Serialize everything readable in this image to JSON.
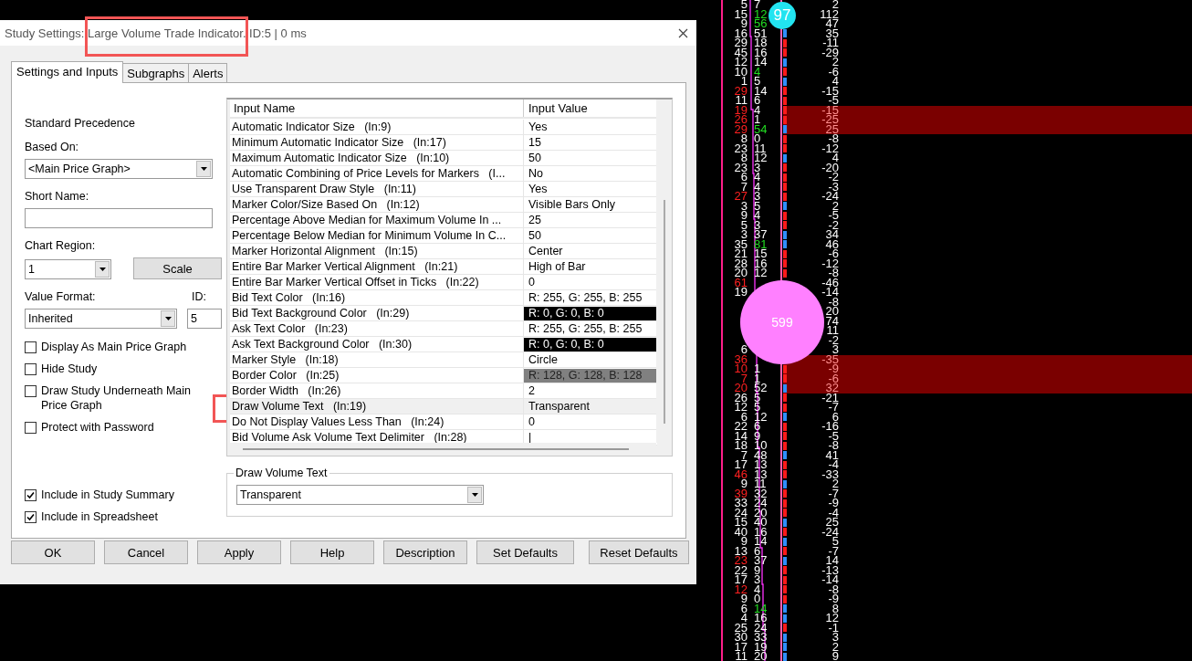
{
  "dialog": {
    "title": "Study Settings: Large Volume Trade Indicator. ID:5 | 0 ms"
  },
  "tabs": [
    {
      "label": "Settings and Inputs",
      "selected": true
    },
    {
      "label": "Subgraphs",
      "selected": false
    },
    {
      "label": "Alerts",
      "selected": false
    }
  ],
  "settings": {
    "precedence": "Standard Precedence",
    "based_on": {
      "label": "Based On:",
      "value": "<Main Price Graph>"
    },
    "short_name": {
      "label": "Short Name:"
    },
    "chart_region": {
      "label": "Chart Region:",
      "value": "1"
    },
    "scale_button": "Scale",
    "value_format": {
      "label": "Value Format:",
      "value": "Inherited"
    },
    "id": {
      "label": "ID:",
      "value": "5"
    }
  },
  "options": [
    {
      "label": "Display As Main Price Graph",
      "checked": false
    },
    {
      "label": "Hide Study",
      "checked": false
    },
    {
      "label": "Draw Study Underneath Main Price Graph",
      "checked": false
    },
    {
      "label": "Protect with Password",
      "checked": false
    }
  ],
  "summary_options": [
    {
      "label": "Include in Study Summary",
      "checked": true
    },
    {
      "label": "Include in Spreadsheet",
      "checked": true
    }
  ],
  "inputs": {
    "columns": [
      "Input Name",
      "Input Value"
    ],
    "rows": [
      {
        "name": "Automatic Indicator Size   (In:9)",
        "value": "Yes",
        "kind": "text",
        "selected": false
      },
      {
        "name": "Minimum Automatic Indicator Size   (In:17)",
        "value": "15",
        "kind": "text",
        "selected": false
      },
      {
        "name": "Maximum Automatic Indicator Size   (In:10)",
        "value": "50",
        "kind": "text",
        "selected": false
      },
      {
        "name": "Automatic Combining of Price Levels for Markers   (I...",
        "value": "No",
        "kind": "text",
        "selected": false
      },
      {
        "name": "Use Transparent Draw Style   (In:11)",
        "value": "Yes",
        "kind": "text",
        "selected": false
      },
      {
        "name": "Marker Color/Size Based On   (In:12)",
        "value": "Visible Bars Only",
        "kind": "text",
        "selected": false
      },
      {
        "name": "Percentage Above Median for Maximum Volume In ...",
        "value": "25",
        "kind": "text",
        "selected": false
      },
      {
        "name": "Percentage Below Median for Minimum Volume In C...",
        "value": "50",
        "kind": "text",
        "selected": false
      },
      {
        "name": "Marker Horizontal Alignment   (In:15)",
        "value": "Center",
        "kind": "text",
        "selected": false
      },
      {
        "name": "Entire Bar Marker Vertical Alignment   (In:21)",
        "value": "High of Bar",
        "kind": "text",
        "selected": false
      },
      {
        "name": "Entire Bar Marker Vertical Offset in Ticks   (In:22)",
        "value": "0",
        "kind": "text",
        "selected": false
      },
      {
        "name": "Bid Text Color   (In:16)",
        "value": "R: 255, G: 255, B: 255",
        "kind": "color",
        "color": "#ffffff",
        "selected": false
      },
      {
        "name": "Bid Text Background Color   (In:29)",
        "value": "R: 0, G: 0, B: 0",
        "kind": "color",
        "color": "#000000",
        "selected": false
      },
      {
        "name": "Ask Text Color   (In:23)",
        "value": "R: 255, G: 255, B: 255",
        "kind": "color",
        "color": "#ffffff",
        "selected": false
      },
      {
        "name": "Ask Text Background Color   (In:30)",
        "value": "R: 0, G: 0, B: 0",
        "kind": "color",
        "color": "#000000",
        "selected": false
      },
      {
        "name": "Marker Style   (In:18)",
        "value": "Circle",
        "kind": "text",
        "selected": false
      },
      {
        "name": "Border Color   (In:25)",
        "value": "R: 128, G: 128, B: 128",
        "kind": "color",
        "color": "#808080",
        "selected": false
      },
      {
        "name": "Border Width   (In:26)",
        "value": "2",
        "kind": "text",
        "selected": false
      },
      {
        "name": "Draw Volume Text   (In:19)",
        "value": "Transparent",
        "kind": "text",
        "selected": true
      },
      {
        "name": "Do Not Display Values Less Than   (In:24)",
        "value": "0",
        "kind": "text",
        "selected": false
      },
      {
        "name": "Bid Volume Ask Volume Text Delimiter   (In:28)",
        "value": "|",
        "kind": "text",
        "selected": false
      }
    ]
  },
  "group": {
    "title": "Draw Volume Text",
    "value": "Transparent"
  },
  "buttons": [
    "OK",
    "Cancel",
    "Apply",
    "Help",
    "Description",
    "Set Defaults",
    "Reset Defaults"
  ],
  "chart": {
    "rows": [
      {
        "bid": "5",
        "ask": "7",
        "delta": "2",
        "bid_red": false,
        "ask_green": false,
        "highlight": false
      },
      {
        "bid": "15",
        "ask": "12",
        "delta": "112",
        "bid_red": false,
        "ask_green": true,
        "highlight": false,
        "marker": {
          "text": "97",
          "color": "#22e4f0"
        }
      },
      {
        "bid": "9",
        "ask": "56",
        "delta": "47",
        "bid_red": false,
        "ask_green": true,
        "highlight": false
      },
      {
        "bid": "16",
        "ask": "51",
        "delta": "35",
        "bid_red": false,
        "ask_green": false,
        "highlight": false,
        "color": "#2f8fff"
      },
      {
        "bid": "29",
        "ask": "18",
        "delta": "-11",
        "bid_red": false,
        "ask_green": false,
        "highlight": false,
        "color": "#ff1a1a"
      },
      {
        "bid": "45",
        "ask": "16",
        "delta": "-29",
        "bid_red": false,
        "ask_green": false,
        "highlight": false,
        "color": "#ff1a1a"
      },
      {
        "bid": "12",
        "ask": "14",
        "delta": "2",
        "bid_red": false,
        "ask_green": false,
        "highlight": false,
        "color": "#2f8fff"
      },
      {
        "bid": "10",
        "ask": "4",
        "delta": "-6",
        "bid_red": false,
        "ask_green": true,
        "highlight": false,
        "color": "#ff1a1a"
      },
      {
        "bid": "1",
        "ask": "5",
        "delta": "4",
        "bid_red": false,
        "ask_green": false,
        "highlight": false,
        "color": "#2f8fff"
      },
      {
        "bid": "29",
        "ask": "14",
        "delta": "-15",
        "bid_red": true,
        "ask_green": false,
        "highlight": false,
        "color": "#ff1a1a"
      },
      {
        "bid": "11",
        "ask": "6",
        "delta": "-5",
        "bid_red": false,
        "ask_green": false,
        "highlight": false,
        "color": "#ff1a1a"
      },
      {
        "bid": "19",
        "ask": "4",
        "delta": "-15",
        "bid_red": true,
        "ask_green": false,
        "highlight": true,
        "color": "#ff1a1a"
      },
      {
        "bid": "26",
        "ask": "1",
        "delta": "-25",
        "bid_red": true,
        "ask_green": false,
        "highlight": true,
        "color": "#ff1a1a"
      },
      {
        "bid": "29",
        "ask": "54",
        "delta": "25",
        "bid_red": true,
        "ask_green": true,
        "highlight": true,
        "color": "#2f8fff"
      },
      {
        "bid": "8",
        "ask": "0",
        "delta": "-8",
        "bid_red": false,
        "ask_green": false,
        "highlight": false,
        "color": "#ff1a1a"
      },
      {
        "bid": "23",
        "ask": "11",
        "delta": "-12",
        "bid_red": false,
        "ask_green": false,
        "highlight": false,
        "color": "#ff1a1a"
      },
      {
        "bid": "8",
        "ask": "12",
        "delta": "4",
        "bid_red": false,
        "ask_green": false,
        "highlight": false,
        "color": "#2f8fff"
      },
      {
        "bid": "23",
        "ask": "3",
        "delta": "-20",
        "bid_red": false,
        "ask_green": false,
        "highlight": false,
        "color": "#ff1a1a"
      },
      {
        "bid": "6",
        "ask": "4",
        "delta": "-2",
        "bid_red": false,
        "ask_green": false,
        "highlight": false,
        "color": "#ff1a1a"
      },
      {
        "bid": "7",
        "ask": "4",
        "delta": "-3",
        "bid_red": false,
        "ask_green": false,
        "highlight": false,
        "color": "#ff1a1a"
      },
      {
        "bid": "27",
        "ask": "3",
        "delta": "-24",
        "bid_red": true,
        "ask_green": false,
        "highlight": false,
        "color": "#ff1a1a"
      },
      {
        "bid": "3",
        "ask": "5",
        "delta": "2",
        "bid_red": false,
        "ask_green": false,
        "highlight": false,
        "color": "#2f8fff"
      },
      {
        "bid": "9",
        "ask": "4",
        "delta": "-5",
        "bid_red": false,
        "ask_green": false,
        "highlight": false,
        "color": "#ff1a1a"
      },
      {
        "bid": "5",
        "ask": "3",
        "delta": "-2",
        "bid_red": false,
        "ask_green": false,
        "highlight": false,
        "color": "#ff1a1a"
      },
      {
        "bid": "3",
        "ask": "37",
        "delta": "34",
        "bid_red": false,
        "ask_green": false,
        "highlight": false,
        "color": "#2f8fff"
      },
      {
        "bid": "35",
        "ask": "81",
        "delta": "46",
        "bid_red": false,
        "ask_green": true,
        "highlight": false,
        "color": "#2f8fff"
      },
      {
        "bid": "21",
        "ask": "15",
        "delta": "-6",
        "bid_red": false,
        "ask_green": false,
        "highlight": false,
        "color": "#ff1a1a"
      },
      {
        "bid": "28",
        "ask": "16",
        "delta": "-12",
        "bid_red": false,
        "ask_green": false,
        "highlight": false,
        "color": "#ff1a1a"
      },
      {
        "bid": "20",
        "ask": "12",
        "delta": "-8",
        "bid_red": false,
        "ask_green": false,
        "highlight": false,
        "color": "#ff1a1a"
      },
      {
        "bid": "61",
        "delta": "-46",
        "bid_red": true,
        "highlight": false
      },
      {
        "bid": "19",
        "delta": "-14",
        "bid_red": false,
        "highlight": false
      },
      {
        "delta": "-8",
        "highlight": false
      },
      {
        "delta": "20",
        "highlight": false
      },
      {
        "delta": "74",
        "highlight": false,
        "marker": {
          "text": "599",
          "color": "#ff80ff"
        }
      },
      {
        "delta": "11",
        "highlight": false
      },
      {
        "delta": "-2",
        "highlight": false
      },
      {
        "bid": "6",
        "delta": "3",
        "bid_red": false,
        "highlight": false
      },
      {
        "bid": "36",
        "delta": "-35",
        "bid_red": true,
        "highlight": true
      },
      {
        "bid": "10",
        "ask": "1",
        "delta": "-9",
        "bid_red": true,
        "ask_green": false,
        "highlight": true,
        "color": "#ff1a1a"
      },
      {
        "bid": "7",
        "ask": "1",
        "delta": "-6",
        "bid_red": true,
        "ask_green": false,
        "highlight": true,
        "color": "#ff1a1a"
      },
      {
        "bid": "20",
        "ask": "52",
        "delta": "32",
        "bid_red": true,
        "ask_green": false,
        "highlight": true,
        "color": "#2f8fff"
      },
      {
        "bid": "26",
        "ask": "5",
        "delta": "-21",
        "bid_red": false,
        "ask_green": false,
        "highlight": false,
        "color": "#ff1a1a"
      },
      {
        "bid": "12",
        "ask": "5",
        "delta": "-7",
        "bid_red": false,
        "ask_green": false,
        "highlight": false,
        "color": "#ff1a1a"
      },
      {
        "bid": "6",
        "ask": "12",
        "delta": "6",
        "bid_red": false,
        "ask_green": false,
        "highlight": false,
        "color": "#2f8fff"
      },
      {
        "bid": "22",
        "ask": "6",
        "delta": "-16",
        "bid_red": false,
        "ask_green": false,
        "highlight": false,
        "color": "#ff1a1a"
      },
      {
        "bid": "14",
        "ask": "9",
        "delta": "-5",
        "bid_red": false,
        "ask_green": false,
        "highlight": false,
        "color": "#ff1a1a"
      },
      {
        "bid": "18",
        "ask": "10",
        "delta": "-8",
        "bid_red": false,
        "ask_green": false,
        "highlight": false,
        "color": "#ff1a1a"
      },
      {
        "bid": "7",
        "ask": "48",
        "delta": "41",
        "bid_red": false,
        "ask_green": false,
        "highlight": false,
        "color": "#2f8fff"
      },
      {
        "bid": "17",
        "ask": "13",
        "delta": "-4",
        "bid_red": false,
        "ask_green": false,
        "highlight": false,
        "color": "#ff1a1a"
      },
      {
        "bid": "46",
        "ask": "13",
        "delta": "-33",
        "bid_red": true,
        "ask_green": false,
        "highlight": false,
        "color": "#ff1a1a"
      },
      {
        "bid": "9",
        "ask": "11",
        "delta": "2",
        "bid_red": false,
        "ask_green": false,
        "highlight": false,
        "color": "#2f8fff"
      },
      {
        "bid": "39",
        "ask": "32",
        "delta": "-7",
        "bid_red": true,
        "ask_green": false,
        "highlight": false,
        "color": "#ff1a1a"
      },
      {
        "bid": "33",
        "ask": "24",
        "delta": "-9",
        "bid_red": false,
        "ask_green": false,
        "highlight": false,
        "color": "#ff1a1a"
      },
      {
        "bid": "24",
        "ask": "20",
        "delta": "-4",
        "bid_red": false,
        "ask_green": false,
        "highlight": false,
        "color": "#ff1a1a"
      },
      {
        "bid": "15",
        "ask": "40",
        "delta": "25",
        "bid_red": false,
        "ask_green": false,
        "highlight": false,
        "color": "#2f8fff"
      },
      {
        "bid": "40",
        "ask": "16",
        "delta": "-24",
        "bid_red": false,
        "ask_green": false,
        "highlight": false,
        "color": "#ff1a1a"
      },
      {
        "bid": "9",
        "ask": "14",
        "delta": "5",
        "bid_red": false,
        "ask_green": false,
        "highlight": false,
        "color": "#2f8fff"
      },
      {
        "bid": "13",
        "ask": "6",
        "delta": "-7",
        "bid_red": false,
        "ask_green": false,
        "highlight": false,
        "color": "#ff1a1a"
      },
      {
        "bid": "23",
        "ask": "37",
        "delta": "14",
        "bid_red": true,
        "ask_green": false,
        "highlight": false,
        "color": "#2f8fff"
      },
      {
        "bid": "22",
        "ask": "9",
        "delta": "-13",
        "bid_red": false,
        "ask_green": false,
        "highlight": false,
        "color": "#ff1a1a"
      },
      {
        "bid": "17",
        "ask": "3",
        "delta": "-14",
        "bid_red": false,
        "ask_green": false,
        "highlight": false,
        "color": "#ff1a1a"
      },
      {
        "bid": "12",
        "ask": "4",
        "delta": "-8",
        "bid_red": true,
        "ask_green": false,
        "highlight": false,
        "color": "#ff1a1a"
      },
      {
        "bid": "9",
        "ask": "0",
        "delta": "-9",
        "bid_red": false,
        "ask_green": false,
        "highlight": false,
        "color": "#ff1a1a"
      },
      {
        "bid": "6",
        "ask": "14",
        "delta": "8",
        "bid_red": false,
        "ask_green": true,
        "highlight": false,
        "color": "#2f8fff"
      },
      {
        "bid": "4",
        "ask": "16",
        "delta": "12",
        "bid_red": false,
        "ask_green": false,
        "highlight": false,
        "color": "#2f8fff"
      },
      {
        "bid": "25",
        "ask": "24",
        "delta": "-1",
        "bid_red": false,
        "ask_green": false,
        "highlight": false,
        "color": "#ff1a1a"
      },
      {
        "bid": "30",
        "ask": "33",
        "delta": "3",
        "bid_red": false,
        "ask_green": false,
        "highlight": false,
        "color": "#2f8fff"
      },
      {
        "bid": "17",
        "ask": "19",
        "delta": "2",
        "bid_red": false,
        "ask_green": false,
        "highlight": false,
        "color": "#2f8fff"
      },
      {
        "bid": "11",
        "ask": "20",
        "delta": "9",
        "bid_red": false,
        "ask_green": false,
        "highlight": false,
        "color": "#2f8fff"
      }
    ]
  }
}
